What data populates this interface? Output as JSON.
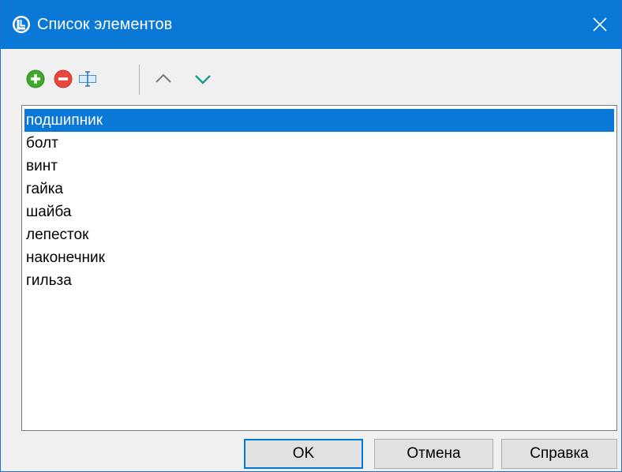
{
  "window": {
    "title": "Список элементов",
    "accent_color": "#0a78d7"
  },
  "titlebar": {
    "app_icon": "app-logo-icon",
    "close_icon": "close-icon"
  },
  "toolbar": {
    "add_icon": "add-icon",
    "remove_icon": "remove-icon",
    "rename_icon": "rename-icon",
    "move_up_icon": "chevron-up-icon",
    "move_down_icon": "chevron-down-icon"
  },
  "list": {
    "items": [
      "подшипник",
      "болт",
      "винт",
      "гайка",
      "шайба",
      "лепесток",
      "наконечник",
      "гильза"
    ],
    "selected_index": 0
  },
  "buttons": {
    "ok": "OK",
    "cancel": "Отмена",
    "help": "Справка"
  }
}
